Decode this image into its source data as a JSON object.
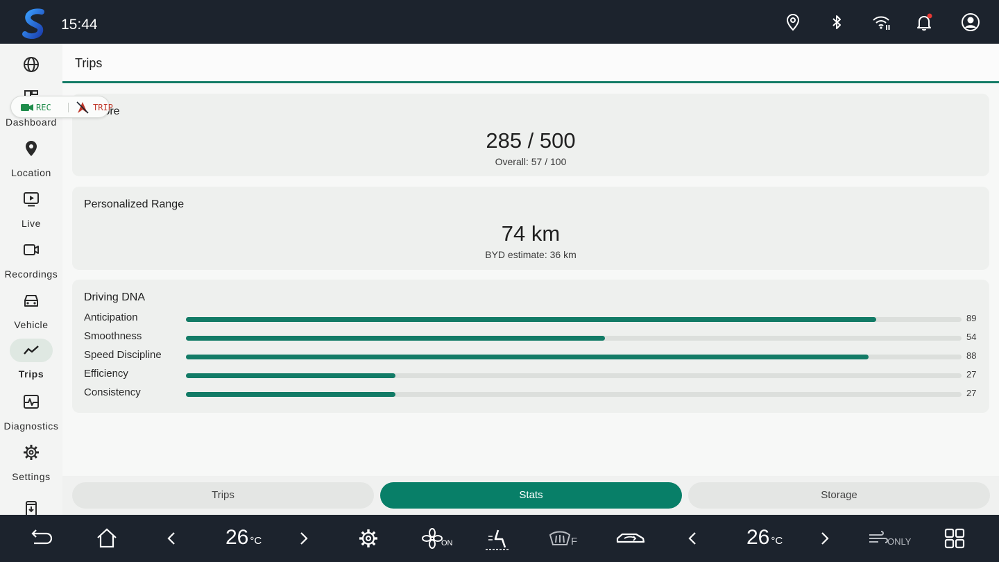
{
  "status_bar": {
    "time": "15:44",
    "icons": [
      "location-pin-icon",
      "bluetooth-icon",
      "wifi-icon",
      "notification-bell-icon",
      "account-icon"
    ],
    "notification_dot_color": "#e53935"
  },
  "sidebar": {
    "items": [
      {
        "icon": "globe-icon",
        "label": ""
      },
      {
        "icon": "dashboard-grid-icon",
        "label": "Dashboard"
      },
      {
        "icon": "location-pin-icon",
        "label": "Location"
      },
      {
        "icon": "live-play-icon",
        "label": "Live"
      },
      {
        "icon": "video-camera-icon",
        "label": "Recordings"
      },
      {
        "icon": "car-icon",
        "label": "Vehicle"
      },
      {
        "icon": "trend-line-icon",
        "label": "Trips",
        "active": true
      },
      {
        "icon": "diagnostics-pulse-icon",
        "label": "Diagnostics"
      },
      {
        "icon": "gear-icon",
        "label": "Settings"
      },
      {
        "icon": "install-download-icon",
        "label": ""
      }
    ],
    "rec_badge": {
      "rec_label": "REC",
      "trip_label": "TRIP"
    }
  },
  "page": {
    "title": "Trips",
    "accent_color": "#137b66"
  },
  "cards": {
    "score": {
      "title": "r Score",
      "value": "285 / 500",
      "subtitle": "Overall: 57 / 100"
    },
    "range": {
      "title": "Personalized Range",
      "value": "74 km",
      "subtitle": "BYD estimate: 36 km"
    },
    "dna": {
      "title": "Driving DNA",
      "max": 100,
      "metrics": [
        {
          "label": "Anticipation",
          "value": 89
        },
        {
          "label": "Smoothness",
          "value": 54
        },
        {
          "label": "Speed Discipline",
          "value": 88
        },
        {
          "label": "Efficiency",
          "value": 27
        },
        {
          "label": "Consistency",
          "value": 27
        }
      ]
    }
  },
  "tabs": [
    {
      "label": "Trips",
      "active": false
    },
    {
      "label": "Stats",
      "active": true
    },
    {
      "label": "Storage",
      "active": false
    }
  ],
  "climate_bar": {
    "left_temp": "26",
    "right_temp": "26",
    "temp_unit": "°C",
    "fan_label": "ON",
    "defrost_label": "F",
    "airflow_label": "ONLY"
  }
}
